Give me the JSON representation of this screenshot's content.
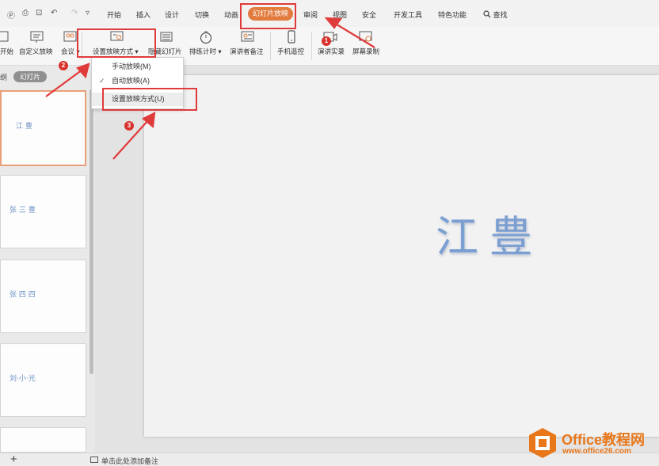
{
  "quick_access": [
    "Ⓟ",
    "⎙",
    "⊡",
    "↶",
    "↷",
    "▿"
  ],
  "menu": {
    "tabs": [
      "开始",
      "插入",
      "设计",
      "切换",
      "动画",
      "幻灯片放映",
      "审阅",
      "视图",
      "安全",
      "开发工具",
      "特色功能"
    ],
    "active_tab": "幻灯片放映",
    "search_label": "查找"
  },
  "ribbon": {
    "buttons": [
      {
        "label": "开始"
      },
      {
        "label": "自定义放映"
      },
      {
        "label": "会议 ▾"
      },
      {
        "label": "设置放映方式 ▾"
      },
      {
        "label": "隐藏幻灯片"
      },
      {
        "label": "排练计时 ▾"
      },
      {
        "label": "演讲者备注"
      },
      {
        "label": "手机遥控"
      },
      {
        "label": "演讲实录"
      },
      {
        "label": "屏幕录制"
      }
    ]
  },
  "dropdown": {
    "items": [
      {
        "label": "手动放映(M)",
        "checked": false
      },
      {
        "label": "自动放映(A)",
        "checked": true
      },
      {
        "label": "设置放映方式(U)",
        "checked": false
      }
    ]
  },
  "panel": {
    "outline_label": "纲",
    "slides_label": "幻灯片",
    "thumbnails": [
      {
        "text": "江 豊",
        "selected": true
      },
      {
        "text": "张 三 豊",
        "selected": false
      },
      {
        "text": "张 四 四",
        "selected": false
      },
      {
        "text": "刘·小·光",
        "selected": false
      }
    ]
  },
  "slide": {
    "text": "江豊"
  },
  "status": {
    "add_symbol": "+",
    "notes_placeholder": "单击此处添加备注"
  },
  "annotations": {
    "badges": [
      "1",
      "2",
      "3"
    ]
  },
  "watermark": {
    "line1": "Office教程网",
    "line2": "www.office26.com"
  },
  "colors": {
    "accent": "#e27b3d",
    "highlight": "#e03b3b",
    "watermark": "#e8771a"
  }
}
